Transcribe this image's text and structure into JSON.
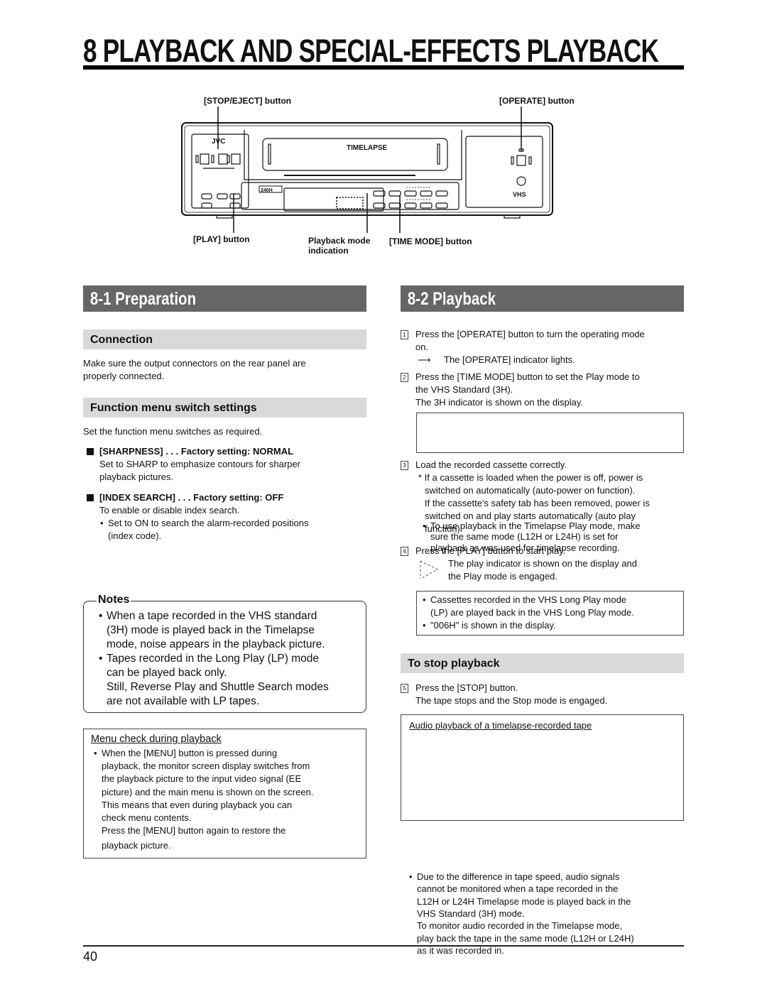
{
  "header": {
    "chapter_title": "8  PLAYBACK AND SPECIAL-EFFECTS PLAYBACK"
  },
  "diagram": {
    "labels": {
      "stop_eject": "[STOP/EJECT] button",
      "operate": "[OPERATE] button",
      "play": "[PLAY] button",
      "playback_mode_1": "Playback mode",
      "playback_mode_2": "indication",
      "time_mode": "[TIME MODE] button"
    },
    "device_text": {
      "brand": "JVC",
      "logo": "TIMELAPSE",
      "counter": "240H",
      "format": "VHS"
    }
  },
  "left": {
    "section_title": "8-1  Preparation",
    "connection": {
      "heading": "Connection",
      "text_1": "Make sure the output connectors on the rear panel are",
      "text_2": "properly connected."
    },
    "function_menu": {
      "heading": "Function menu switch settings",
      "intro": "Set the function menu switches as required.",
      "items": [
        {
          "title": "[SHARPNESS] . . . Factory setting: NORMAL",
          "lines": [
            "Set to SHARP to emphasize contours for sharper",
            "playback pictures."
          ]
        },
        {
          "title": "[INDEX SEARCH] . . . Factory setting: OFF",
          "lines": [
            "To enable or disable index search."
          ],
          "bullet_1": "Set to ON to search the alarm-recorded positions",
          "bullet_2": "(index code)."
        }
      ]
    },
    "notes": {
      "label": "Notes",
      "items": [
        [
          "When a tape recorded in the VHS standard",
          "(3H) mode is played back in the Timelapse",
          "mode, noise appears in the playback picture."
        ],
        [
          "Tapes recorded in the Long Play (LP) mode",
          "can be played back only.",
          "Still, Reverse Play and Shuttle Search modes",
          "are not available with LP tapes."
        ]
      ]
    },
    "menu_check": {
      "title": "Menu check during playback",
      "lines": [
        "When the [MENU] button is pressed during",
        "playback, the monitor screen display switches from",
        "the playback picture to the input video signal (EE",
        "picture) and the main menu is shown on the screen.",
        "This means that even during playback you can",
        "check menu contents.",
        "Press the [MENU] button again to restore the",
        "playback picture."
      ]
    }
  },
  "right": {
    "section_title": "8-2  Playback",
    "steps": [
      {
        "num": "1",
        "lines": [
          "Press the [OPERATE] button to turn the operating mode",
          "on."
        ],
        "result": "The [OPERATE] indicator lights."
      },
      {
        "num": "2",
        "lines": [
          "Press the [TIME MODE] button to set the Play mode to",
          "the VHS Standard (3H).",
          "The 3H indicator is shown on the display."
        ],
        "box": [
          "To use playback in the Timelapse Play mode, make",
          "sure the same mode (L12H or L24H) is set for",
          "playback as was used for timelapse recording."
        ]
      },
      {
        "num": "3",
        "lines": [
          "Load the recorded cassette correctly."
        ],
        "note": [
          "* If a cassette is loaded when the power is off, power is",
          "switched on automatically (auto-power on function).",
          "If the cassette's safety tab has been removed, power is",
          "switched on and play starts automatically (auto play",
          "function)."
        ]
      },
      {
        "num": "4",
        "lines": [
          "Press the [PLAY] button to start play."
        ],
        "result": [
          "The play indicator is shown on the display and",
          "the Play mode is engaged."
        ],
        "box": [
          "Cassettes recorded in the VHS Long Play mode",
          "(LP) are played back in the VHS Long Play mode.",
          "\"006H\" is shown in the display."
        ]
      }
    ],
    "stop": {
      "heading": "To stop playback",
      "num": "5",
      "lines": [
        "Press the [STOP] button.",
        "The tape stops and the Stop mode is engaged."
      ]
    },
    "audio_box": {
      "title": "Audio playback of a timelapse-recorded tape",
      "lines": [
        "Due to the difference in tape speed, audio signals",
        "cannot be monitored when a tape recorded in the",
        "L12H or L24H Timelapse mode is played back in the",
        "VHS Standard (3H) mode.",
        "To monitor audio recorded in the Timelapse mode,",
        "play back the tape in the same mode (L12H or L24H)",
        "as it was recorded in."
      ]
    }
  },
  "footer": {
    "page_number": "40"
  }
}
